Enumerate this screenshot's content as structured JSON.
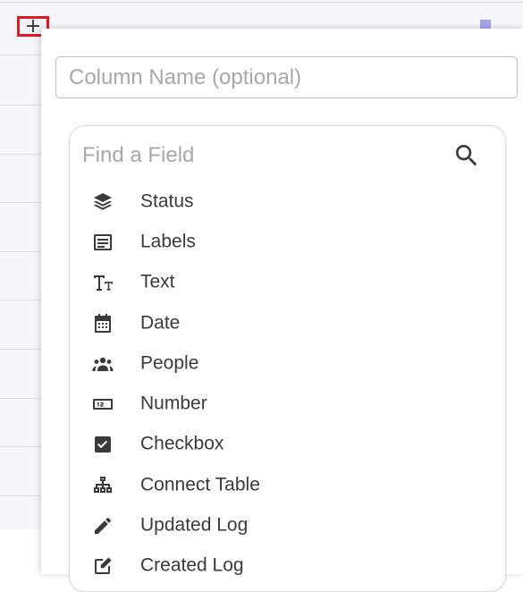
{
  "toolbar": {
    "add_column_label": "+"
  },
  "popup": {
    "column_name_placeholder": "Column Name (optional)",
    "find_field_placeholder": "Find a Field",
    "fields": [
      {
        "label": "Status",
        "icon": "layers-icon"
      },
      {
        "label": "Labels",
        "icon": "labels-icon"
      },
      {
        "label": "Text",
        "icon": "text-icon"
      },
      {
        "label": "Date",
        "icon": "calendar-icon"
      },
      {
        "label": "People",
        "icon": "people-icon"
      },
      {
        "label": "Number",
        "icon": "number-icon"
      },
      {
        "label": "Checkbox",
        "icon": "checkbox-icon"
      },
      {
        "label": "Connect Table",
        "icon": "connect-table-icon"
      },
      {
        "label": "Updated Log",
        "icon": "pencil-icon"
      },
      {
        "label": "Created Log",
        "icon": "edit-box-icon"
      }
    ]
  },
  "colors": {
    "highlight_border": "#e01b24",
    "accent": "#a5a2ee",
    "icon": "#3a3a3a"
  }
}
